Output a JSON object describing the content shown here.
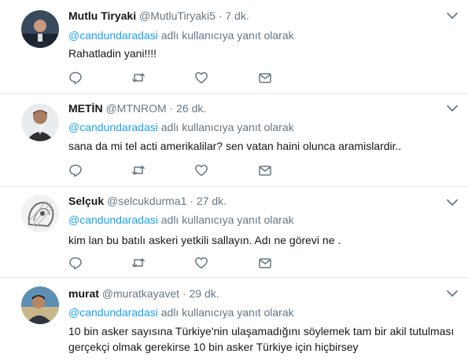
{
  "reply_prefix": "adlı kullanıcıya yanıt olarak",
  "icons": {
    "more": "chevron-down-icon",
    "reply": "reply-icon",
    "retweet": "retweet-icon",
    "like": "heart-icon",
    "message": "direct-message-icon"
  },
  "colors": {
    "link": "#1da1f2",
    "secondary_text": "#657786",
    "divider": "#e6ecf0"
  },
  "tweets": [
    {
      "name": "Mutlu Tiryaki",
      "handle": "@MutluTiryaki5",
      "time": "7 dk.",
      "reply_to": "@candundaradasi",
      "text": "Rahatladin yani!!!!"
    },
    {
      "name": "METİN",
      "handle": "@MTNROM",
      "time": "26 dk.",
      "reply_to": "@candundaradasi",
      "text": "sana da mi tel acti amerikalilar? sen vatan haini olunca aramislardir.."
    },
    {
      "name": "Selçuk",
      "handle": "@selcukdurma1",
      "time": "27 dk.",
      "reply_to": "@candundaradasi",
      "text": "kim lan bu batılı askeri yetkili sallayın. Adı ne görevi ne ."
    },
    {
      "name": "murat",
      "handle": "@muratkayavet",
      "time": "29 dk.",
      "reply_to": "@candundaradasi",
      "text_lines": [
        "10 bin asker sayısına Türkiye'nin ulaşamadığını söylemek tam bir akil tutulması",
        "gerçekçi olmak gerekirse 10 bin asker Türkiye için hiçbirsey"
      ]
    }
  ]
}
